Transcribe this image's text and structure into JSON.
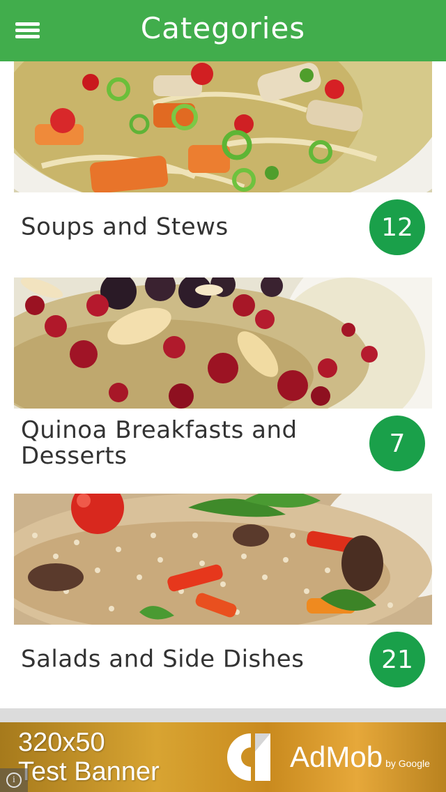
{
  "header": {
    "title": "Categories",
    "menu_icon": "hamburger-menu-icon"
  },
  "categories": [
    {
      "label": "Soups and Stews",
      "count": "12",
      "image": "soup-photo"
    },
    {
      "label": "Quinoa Breakfasts and Desserts",
      "count": "7",
      "image": "quinoa-porridge-photo"
    },
    {
      "label": "Salads and Side Dishes",
      "count": "21",
      "image": "quinoa-salad-photo"
    }
  ],
  "ad": {
    "line1": "320x50",
    "line2": "Test Banner",
    "brand": "AdMob",
    "brand_suffix": "by Google",
    "info_glyph": "i"
  },
  "colors": {
    "header_bg": "#41ad4c",
    "badge_bg": "#1aa04a",
    "label_text": "#333333"
  }
}
